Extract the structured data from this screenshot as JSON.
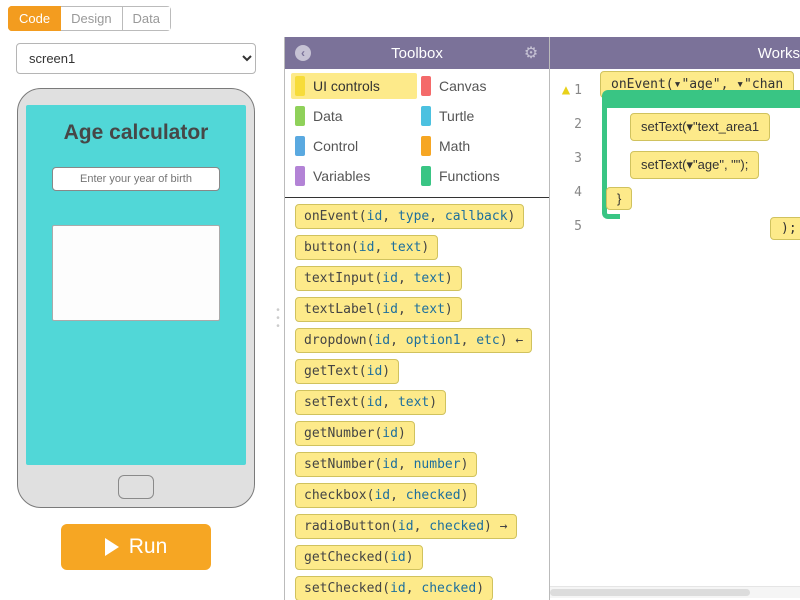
{
  "tabs": {
    "code": "Code",
    "design": "Design",
    "data": "Data"
  },
  "screen_select": "screen1",
  "phone": {
    "title": "Age calculator",
    "input_placeholder": "Enter your year of birth"
  },
  "run_label": "Run",
  "toolbox": {
    "title": "Toolbox",
    "categories": [
      {
        "label": "UI controls",
        "color": "#f7dc3a",
        "active": true
      },
      {
        "label": "Canvas",
        "color": "#f46a6a"
      },
      {
        "label": "Data",
        "color": "#8fd15a"
      },
      {
        "label": "Turtle",
        "color": "#4cc1e0"
      },
      {
        "label": "Control",
        "color": "#5aa9e0"
      },
      {
        "label": "Math",
        "color": "#f6a623"
      },
      {
        "label": "Variables",
        "color": "#b383d6"
      },
      {
        "label": "Functions",
        "color": "#39c584"
      }
    ],
    "blocks": [
      {
        "fn": "onEvent",
        "args": [
          "id",
          "type",
          "callback"
        ]
      },
      {
        "fn": "button",
        "args": [
          "id",
          "text"
        ]
      },
      {
        "fn": "textInput",
        "args": [
          "id",
          "text"
        ]
      },
      {
        "fn": "textLabel",
        "args": [
          "id",
          "text"
        ]
      },
      {
        "fn": "dropdown",
        "args": [
          "id",
          "option1",
          "etc"
        ],
        "trail": " ←"
      },
      {
        "fn": "getText",
        "args": [
          "id"
        ]
      },
      {
        "fn": "setText",
        "args": [
          "id",
          "text"
        ]
      },
      {
        "fn": "getNumber",
        "args": [
          "id"
        ]
      },
      {
        "fn": "setNumber",
        "args": [
          "id",
          "number"
        ]
      },
      {
        "fn": "checkbox",
        "args": [
          "id",
          "checked"
        ]
      },
      {
        "fn": "radioButton",
        "args": [
          "id",
          "checked"
        ],
        "trail": " →"
      },
      {
        "fn": "getChecked",
        "args": [
          "id"
        ]
      },
      {
        "fn": "setChecked",
        "args": [
          "id",
          "checked"
        ]
      }
    ]
  },
  "workspace": {
    "title": "Works",
    "lines": [
      "1",
      "2",
      "3",
      "4",
      "5"
    ],
    "code": {
      "l1": "onEvent(▾\"age\", ▾\"chan",
      "l2": "setText(▾\"text_area1",
      "l3": "setText(▾\"age\", \"\");",
      "l4": "}",
      "tail": ");"
    }
  }
}
